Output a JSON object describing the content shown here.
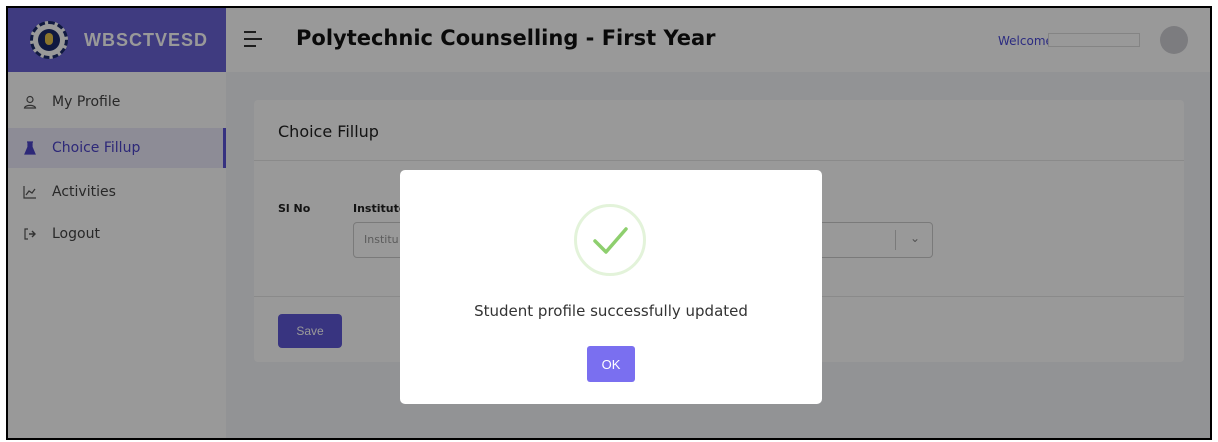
{
  "brand": {
    "name": "WBSCTVESD"
  },
  "header": {
    "title": "Polytechnic Counselling - First Year",
    "welcome": "Welcome"
  },
  "sidebar": {
    "items": [
      {
        "label": "My Profile",
        "icon": "user-icon",
        "active": false
      },
      {
        "label": "Choice Fillup",
        "icon": "flask-icon",
        "active": true
      },
      {
        "label": "Activities",
        "icon": "chart-line-icon",
        "active": false
      },
      {
        "label": "Logout",
        "icon": "logout-icon",
        "active": false
      }
    ]
  },
  "main": {
    "title": "Choice Fillup",
    "columns": {
      "sl_no": "Sl No",
      "institute": "Institute"
    },
    "institute_placeholder": "Institu",
    "save_label": "Save"
  },
  "modal": {
    "message": "Student profile successfully updated",
    "ok_label": "OK"
  },
  "colors": {
    "brand": "#6a63d6",
    "accent": "#5e57d6",
    "ok_button": "#7a6ff0",
    "success_check": "#8ecf6e"
  }
}
